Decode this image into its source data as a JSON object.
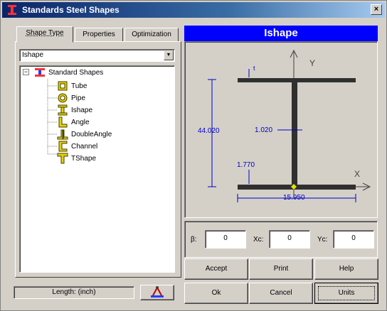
{
  "window": {
    "title": "Standards Steel Shapes",
    "close_glyph": "×"
  },
  "tabs": [
    {
      "label": "Shape Type",
      "active": true
    },
    {
      "label": "Properties",
      "active": false
    },
    {
      "label": "Optimization",
      "active": false
    }
  ],
  "combo": {
    "value": "Ishape",
    "arrow": "▼"
  },
  "tree": {
    "root": "Standard Shapes",
    "expander": "−",
    "items": [
      {
        "label": "Tube",
        "icon": "tube-icon"
      },
      {
        "label": "Pipe",
        "icon": "pipe-icon"
      },
      {
        "label": "Ishape",
        "icon": "ishape-icon"
      },
      {
        "label": "Angle",
        "icon": "angle-icon"
      },
      {
        "label": "DoubleAngle",
        "icon": "double-angle-icon"
      },
      {
        "label": "Channel",
        "icon": "channel-icon"
      },
      {
        "label": "TShape",
        "icon": "tshape-icon"
      }
    ]
  },
  "status": {
    "length_units": "Length: (inch)"
  },
  "shape": {
    "name": "Ishape",
    "dims": {
      "height": "44.020",
      "web": "1.020",
      "flange": "1.770",
      "width": "15.950",
      "top_label": "t"
    },
    "axes": {
      "y": "Y",
      "x": "X"
    }
  },
  "params": {
    "beta_label": "β:",
    "beta_value": "0",
    "xc_label": "Xc:",
    "xc_value": "0",
    "yc_label": "Yc:",
    "yc_value": "0"
  },
  "buttons": {
    "accept": "Accept",
    "print": "Print",
    "help": "Help",
    "ok": "Ok",
    "cancel": "Cancel",
    "units": "Units"
  },
  "colors": {
    "accent": "#0000ff",
    "dimension": "#0000cc",
    "shape": "#303030",
    "icon_yellow": "#e8d000"
  }
}
